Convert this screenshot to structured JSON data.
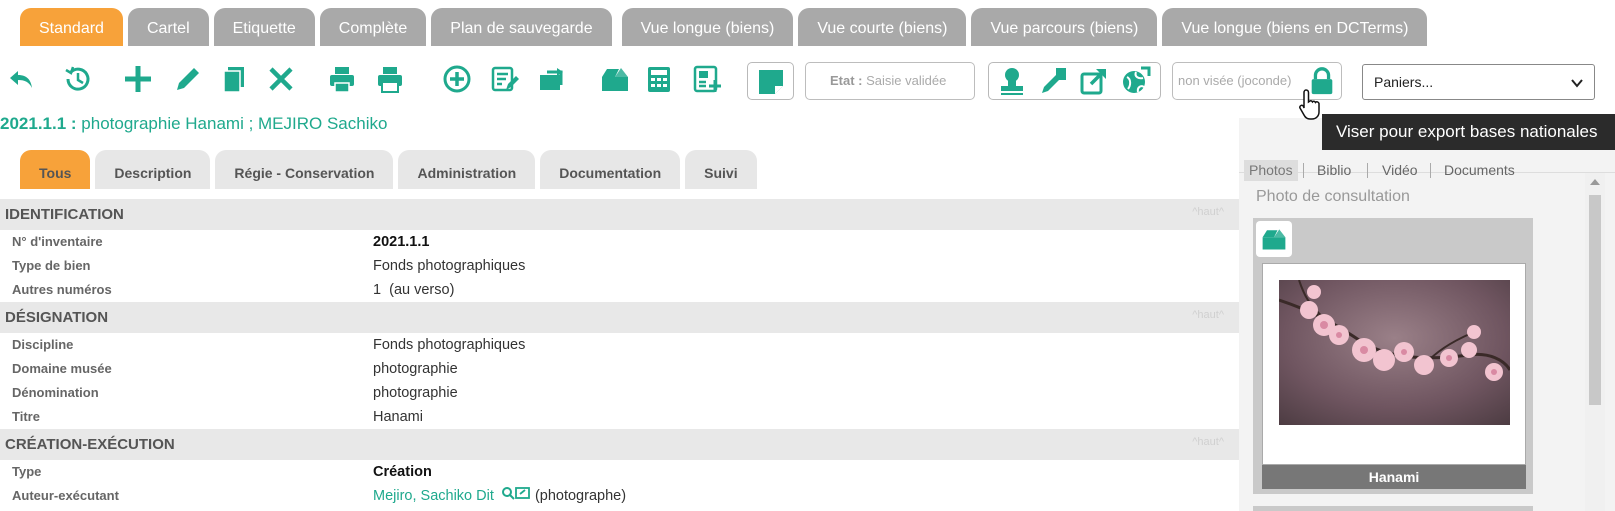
{
  "view_tabs": [
    "Standard",
    "Cartel",
    "Etiquette",
    "Complète",
    "Plan de sauvegarde",
    "Vue longue (biens)",
    "Vue courte (biens)",
    "Vue parcours (biens)",
    "Vue longue (biens en DCTerms)"
  ],
  "toolbar": {
    "etat_label": "Etat :",
    "etat_value": "Saisie validée",
    "visee_text": "non visée (joconde)",
    "select_value": "Paniers...",
    "tooltip": "Viser pour export bases nationales"
  },
  "record": {
    "number": "2021.1.1 :",
    "title": "photographie Hanami ; MEJIRO Sachiko"
  },
  "section_tabs": [
    "Tous",
    "Description",
    "Régie - Conservation",
    "Administration",
    "Documentation",
    "Suivi"
  ],
  "haut": "^haut^",
  "sections": [
    {
      "title": "IDENTIFICATION",
      "rows": [
        {
          "label": "N° d'inventaire",
          "value": "2021.1.1"
        },
        {
          "label": "Type de bien",
          "value": "Fonds photographiques"
        },
        {
          "label": "Autres numéros",
          "value": "1  (au verso)"
        }
      ]
    },
    {
      "title": "DÉSIGNATION",
      "rows": [
        {
          "label": "Discipline",
          "value": "Fonds photographiques"
        },
        {
          "label": "Domaine musée",
          "value": "photographie"
        },
        {
          "label": "Dénomination",
          "value": "photographie"
        },
        {
          "label": "Titre",
          "value": "Hanami"
        }
      ]
    },
    {
      "title": "CRÉATION-EXÉCUTION",
      "rows": [
        {
          "label": "Type",
          "value": "Création"
        },
        {
          "label": "Auteur-exécutant",
          "link": "Mejiro, Sachiko Dit",
          "suffix": "(photographe)"
        }
      ]
    }
  ],
  "media_panel": {
    "tabs": [
      "Photos",
      "Biblio",
      "Vidéo",
      "Documents"
    ],
    "section_label": "Photo de consultation",
    "photo_caption": "Hanami"
  },
  "accent_color": "#1fa98d",
  "active_tab_color": "#f7a23a"
}
